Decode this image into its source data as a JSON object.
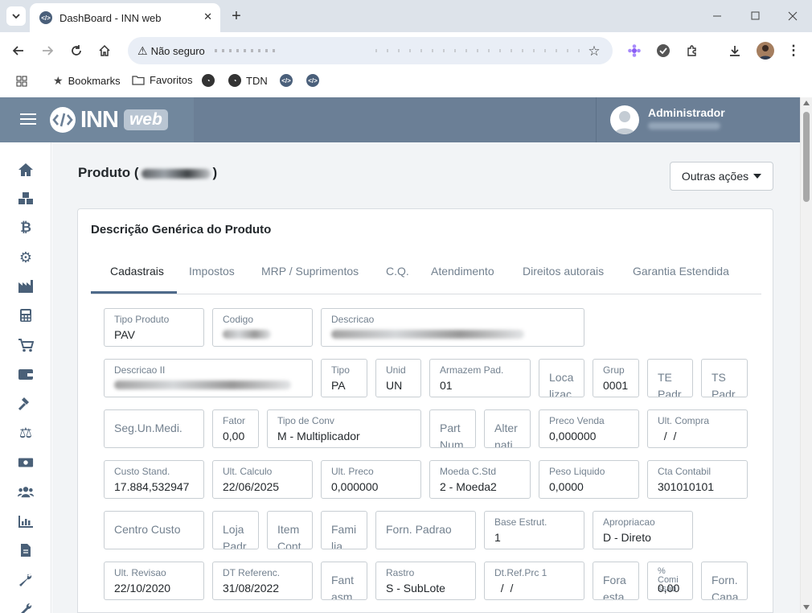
{
  "browser": {
    "tab_title": "DashBoard - INN web",
    "security_label": "Não seguro",
    "bookmarks": [
      {
        "label": "Bookmarks"
      },
      {
        "label": "Favoritos"
      },
      {
        "label": ""
      },
      {
        "label": "TDN"
      },
      {
        "label": ""
      },
      {
        "label": ""
      }
    ]
  },
  "app": {
    "brand_name": "INN",
    "brand_suffix": "web",
    "user_name": "Administrador",
    "page_title_prefix": "Produto (",
    "page_title_suffix": ")",
    "actions_label": "Outras ações",
    "card_title": "Descrição Genérica do Produto",
    "tabs": [
      "Cadastrais",
      "Impostos",
      "MRP / Suprimentos",
      "C.Q.",
      "Atendimento",
      "Direitos autorais",
      "Garantia Estendida"
    ],
    "active_tab": "Cadastrais"
  },
  "sidebar_icons": [
    "home-icon",
    "cubes-icon",
    "bitcoin-icon",
    "gears-icon",
    "industry-chart-icon",
    "calculator-icon",
    "cart-icon",
    "wallet-icon",
    "hammer-icon",
    "scale-icon",
    "money-icon",
    "users-icon",
    "bar-chart-icon",
    "document-icon",
    "wrench-icon",
    "tools-icon"
  ],
  "form": {
    "tipo_produto": {
      "label": "Tipo Produto",
      "value": "PAV"
    },
    "codigo": {
      "label": "Codigo",
      "value": ""
    },
    "descricao": {
      "label": "Descricao",
      "value": ""
    },
    "descricao2": {
      "label": "Descricao II",
      "value": ""
    },
    "tipo": {
      "label": "Tipo",
      "value": "PA"
    },
    "unid": {
      "label": "Unid",
      "value": "UN"
    },
    "armazem": {
      "label": "Armazem Pad.",
      "value": "01"
    },
    "localizacao": {
      "placeholder": "Loca lizac ao"
    },
    "grupo": {
      "label": "Grup",
      "value": "0001"
    },
    "te_padrao": {
      "placeholder": "TE Padr ao"
    },
    "ts_padrao": {
      "placeholder": "TS Padr ao"
    },
    "seg_un_medida": {
      "placeholder": "Seg.Un.Medi."
    },
    "fator": {
      "label": "Fator",
      "value": "0,00"
    },
    "tipo_conv": {
      "label": "Tipo de Conv",
      "value": "M - Multiplicador"
    },
    "part_number": {
      "placeholder": "Part Num ber"
    },
    "alternativo": {
      "placeholder": "Alter nati vo"
    },
    "preco_venda": {
      "label": "Preco Venda",
      "value": "0,000000"
    },
    "ult_compra": {
      "label": "Ult. Compra",
      "value": "  /  /"
    },
    "custo_stand": {
      "label": "Custo Stand.",
      "value": "17.884,532947"
    },
    "ult_calculo": {
      "label": "Ult. Calculo",
      "value": "22/06/2025"
    },
    "ult_preco": {
      "label": "Ult. Preco",
      "value": "0,000000"
    },
    "moeda_cstd": {
      "label": "Moeda C.Std",
      "value": "2 - Moeda2"
    },
    "peso_liquido": {
      "label": "Peso Liquido",
      "value": "0,0000"
    },
    "cta_contabil": {
      "label": "Cta Contabil",
      "value": "301010101"
    },
    "centro_custo": {
      "placeholder": "Centro Custo"
    },
    "loja_padrao": {
      "placeholder": "Loja Padr ao"
    },
    "item_conta": {
      "placeholder": "Item Cont a"
    },
    "familia": {
      "placeholder": "Fami lia"
    },
    "forn_padrao": {
      "placeholder": "Forn. Padrao"
    },
    "base_estrut": {
      "label": "Base Estrut.",
      "value": "1"
    },
    "apropriacao": {
      "label": "Apropriacao",
      "value": "D - Direto"
    },
    "ult_revisao": {
      "label": "Ult. Revisao",
      "value": "22/10/2020"
    },
    "dt_referenc": {
      "label": "DT Referenc.",
      "value": "31/08/2022"
    },
    "fantasma": {
      "placeholder": "Fant asm a"
    },
    "rastro": {
      "label": "Rastro",
      "value": "S - SubLote"
    },
    "dt_ref_prc1": {
      "label": "Dt.Ref.Prc 1",
      "value": "  /  /"
    },
    "fora_estado": {
      "placeholder": "Fora esta do"
    },
    "perc_comissao": {
      "label": "% Comi ssao",
      "value": "0,00"
    },
    "forn_canal": {
      "placeholder": "Forn. Cana l"
    }
  }
}
